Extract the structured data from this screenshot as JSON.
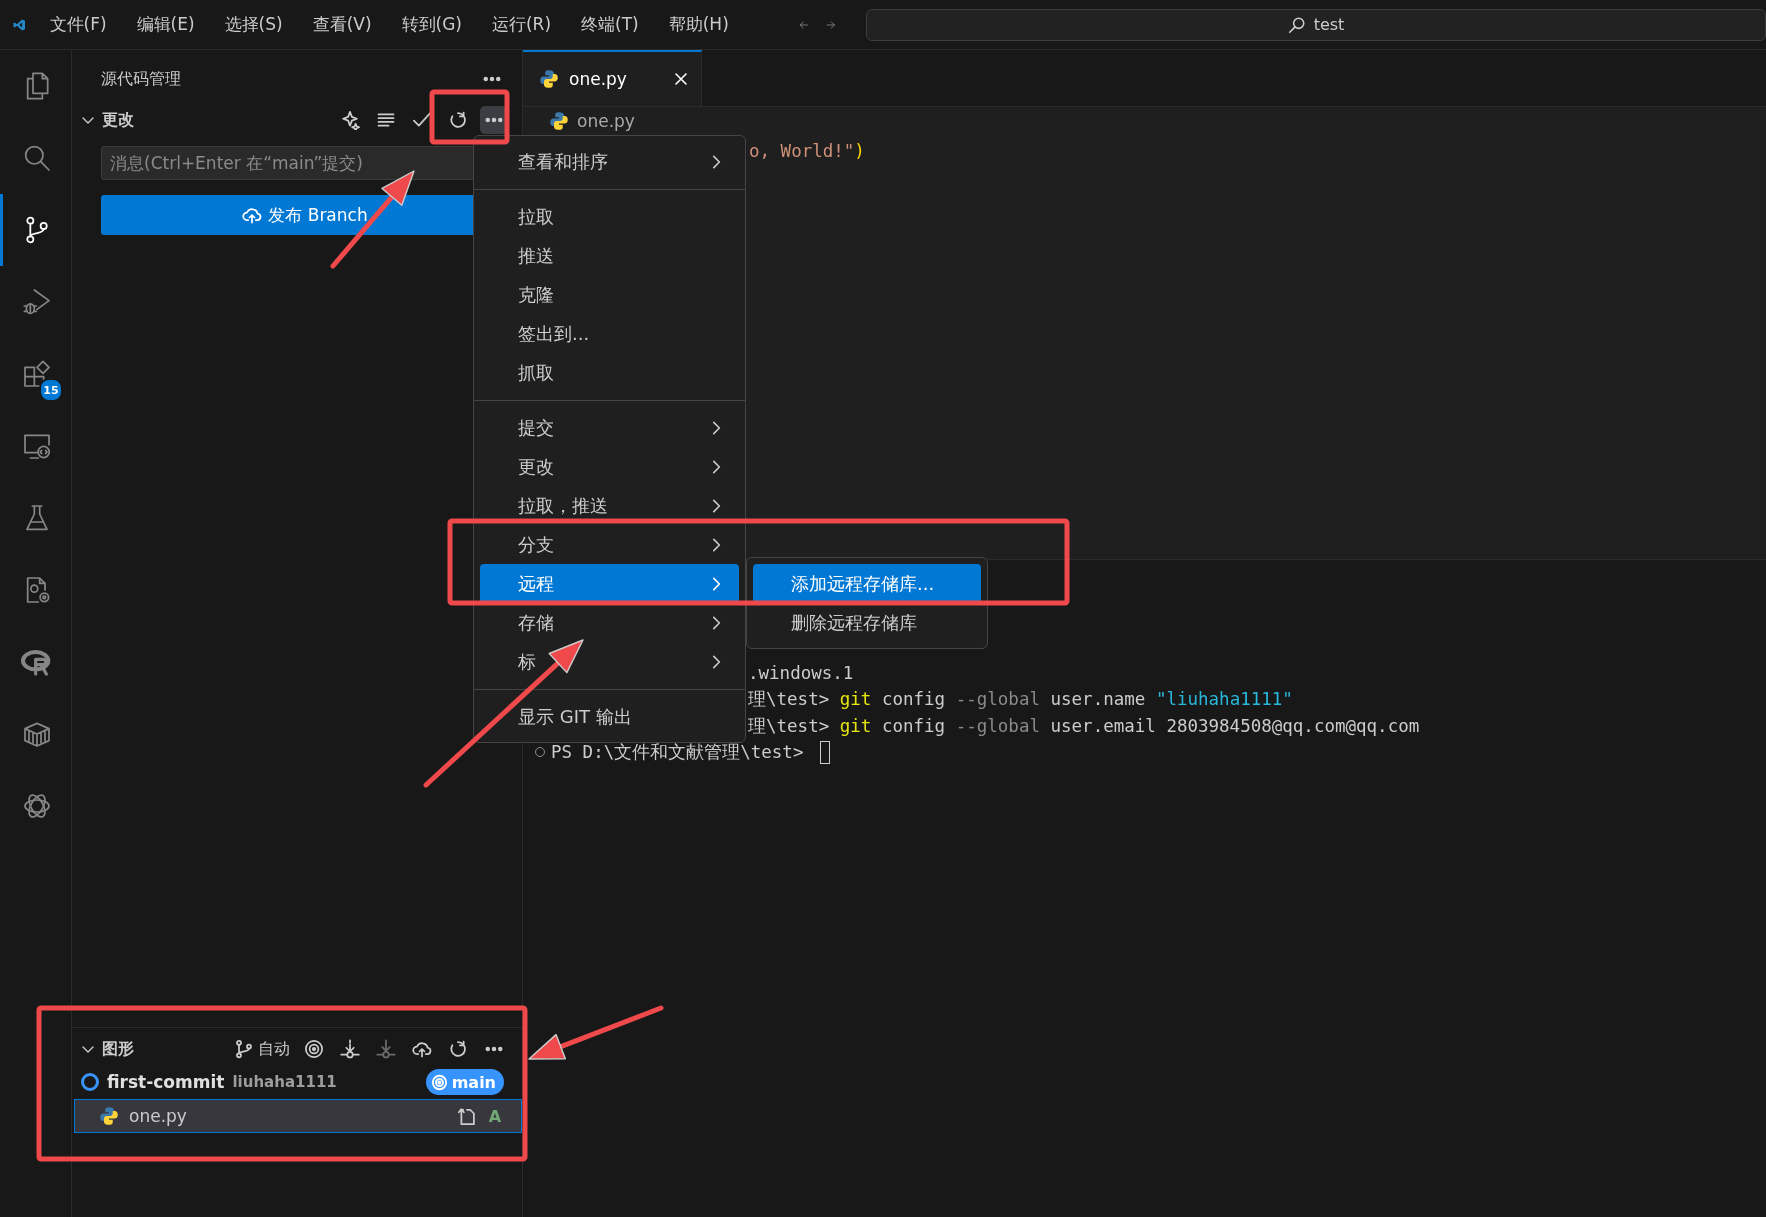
{
  "title_bar": {
    "menus": [
      "文件(F)",
      "编辑(E)",
      "选择(S)",
      "查看(V)",
      "转到(G)",
      "运行(R)",
      "终端(T)",
      "帮助(H)"
    ],
    "search": {
      "value": "test"
    }
  },
  "activity_bar": {
    "items": [
      {
        "kind": "explorer",
        "selected": false
      },
      {
        "kind": "search",
        "selected": false
      },
      {
        "kind": "source-control",
        "selected": true
      },
      {
        "kind": "run-debug",
        "selected": false
      },
      {
        "kind": "extensions",
        "selected": false,
        "badge": "15"
      },
      {
        "kind": "remote",
        "selected": false
      },
      {
        "kind": "testing",
        "selected": false
      },
      {
        "kind": "cpp-config",
        "selected": false
      },
      {
        "kind": "r-lang",
        "selected": false
      },
      {
        "kind": "containers",
        "selected": false
      },
      {
        "kind": "chat",
        "selected": false
      }
    ]
  },
  "sidebar": {
    "title": "源代码管理",
    "changes": {
      "title": "更改",
      "expanded": true,
      "actions": [
        {
          "kind": "sparkle",
          "pressed": false
        },
        {
          "kind": "list",
          "pressed": false
        },
        {
          "kind": "check",
          "pressed": false
        },
        {
          "kind": "refresh",
          "pressed": false
        },
        {
          "kind": "more",
          "pressed": true
        }
      ],
      "message": {
        "placeholder": "消息(Ctrl+Enter 在“main”提交)"
      },
      "publish_button": "发布 Branch"
    },
    "graph": {
      "title": "图形",
      "expanded": true,
      "branch_filter": "自动",
      "actions": [
        {
          "kind": "target",
          "disabled": false
        },
        {
          "kind": "fetch",
          "disabled": false
        },
        {
          "kind": "pull",
          "disabled": true
        },
        {
          "kind": "push",
          "disabled": false
        },
        {
          "kind": "refresh",
          "disabled": false
        },
        {
          "kind": "more",
          "disabled": false
        }
      ],
      "commits": [
        {
          "message": "first-commit",
          "author": "liuhaha1111",
          "ref": "main",
          "files": [
            {
              "name": "one.py",
              "status": "A",
              "selected": true
            }
          ]
        }
      ]
    }
  },
  "editor": {
    "tabs": [
      {
        "label": "one.py",
        "selected": true
      }
    ],
    "breadcrumb": "one.py",
    "code_line": [
      {
        "kind": "string",
        "text": "o, World!\""
      },
      {
        "kind": "paren",
        "text": ")"
      }
    ]
  },
  "terminal": {
    "lines": [
      {
        "kind": "clipped",
        "marker": false,
        "cursor": false,
        "segments": [
          {
            "kind": "text",
            "text": ".windows.1"
          }
        ]
      },
      {
        "kind": "clipped",
        "marker": false,
        "cursor": false,
        "segments": [
          {
            "kind": "text",
            "text": "理\\test> "
          },
          {
            "kind": "command",
            "text": "git"
          },
          {
            "kind": "text",
            "text": " config "
          },
          {
            "kind": "flag",
            "text": "--global"
          },
          {
            "kind": "text",
            "text": " user.name "
          },
          {
            "kind": "string",
            "text": "\"liuhaha1111\""
          }
        ]
      },
      {
        "kind": "clipped",
        "marker": false,
        "cursor": false,
        "segments": [
          {
            "kind": "text",
            "text": "理\\test> "
          },
          {
            "kind": "command",
            "text": "git"
          },
          {
            "kind": "text",
            "text": " config "
          },
          {
            "kind": "flag",
            "text": "--global"
          },
          {
            "kind": "text",
            "text": " user.email 2803984508@qq.com@qq.com"
          }
        ]
      },
      {
        "kind": "full",
        "marker": true,
        "cursor": true,
        "segments": [
          {
            "kind": "text",
            "text": "PS D:\\文件和文献管理\\test> "
          }
        ]
      }
    ]
  },
  "context_menu": {
    "groups": [
      [
        {
          "label": "查看和排序",
          "submenu": true,
          "selected": false
        }
      ],
      [
        {
          "label": "拉取",
          "submenu": false,
          "selected": false
        },
        {
          "label": "推送",
          "submenu": false,
          "selected": false
        },
        {
          "label": "克隆",
          "submenu": false,
          "selected": false
        },
        {
          "label": "签出到...",
          "submenu": false,
          "selected": false
        },
        {
          "label": "抓取",
          "submenu": false,
          "selected": false
        }
      ],
      [
        {
          "label": "提交",
          "submenu": true,
          "selected": false
        },
        {
          "label": "更改",
          "submenu": true,
          "selected": false
        },
        {
          "label": "拉取，推送",
          "submenu": true,
          "selected": false
        },
        {
          "label": "分支",
          "submenu": true,
          "selected": false
        },
        {
          "label": "远程",
          "submenu": true,
          "selected": true
        },
        {
          "label": "存储",
          "submenu": true,
          "selected": false
        },
        {
          "label": "标",
          "submenu": true,
          "selected": false
        }
      ],
      [
        {
          "label": "显示 GIT 输出",
          "submenu": false,
          "selected": false
        }
      ]
    ],
    "submenu": {
      "items": [
        {
          "label": "添加远程存储库...",
          "selected": true
        },
        {
          "label": "删除远程存储库",
          "selected": false
        }
      ]
    }
  }
}
